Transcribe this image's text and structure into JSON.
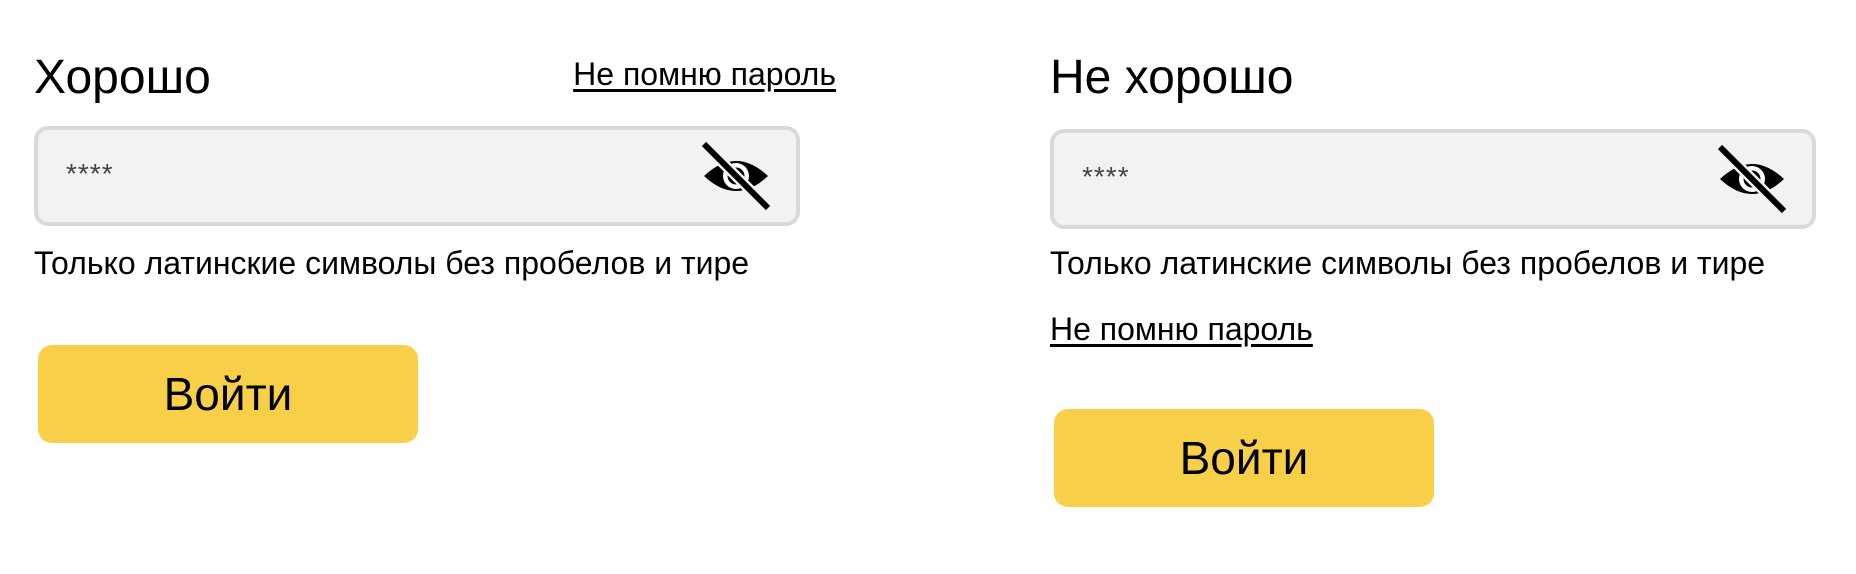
{
  "colors": {
    "button": "#f8cf48",
    "field_background": "#f2f2f2",
    "field_border": "#d9d9d9"
  },
  "good_example": {
    "title": "Хорошо",
    "forgot_password": "Не помню пароль",
    "password_value": "****",
    "visibility_icon": "eye-off-icon",
    "hint": "Только латинские символы без пробелов и тире",
    "login_label": "Войти"
  },
  "bad_example": {
    "title": "Не хорошо",
    "password_value": "****",
    "visibility_icon": "eye-off-icon",
    "hint": "Только латинские символы без пробелов и тире",
    "forgot_password": "Не помню пароль",
    "login_label": "Войти"
  }
}
